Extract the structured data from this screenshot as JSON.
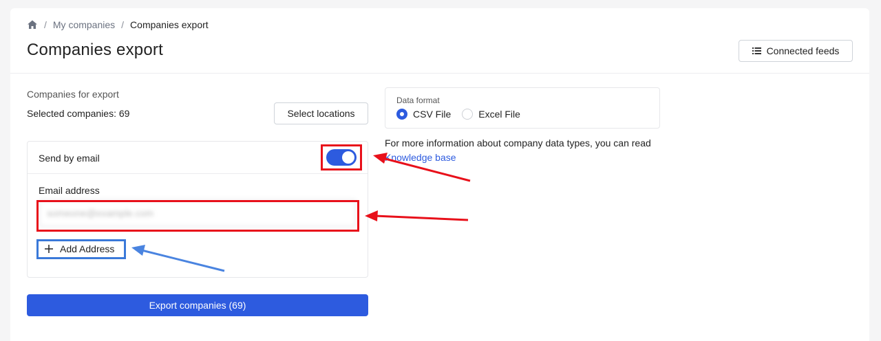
{
  "breadcrumb": {
    "home_icon": "home-icon",
    "separator": "/",
    "my_companies": "My companies",
    "current": "Companies export"
  },
  "header": {
    "title": "Companies export",
    "connected_feeds_label": "Connected feeds",
    "connected_feeds_icon": "list-icon"
  },
  "export": {
    "section_label": "Companies for export",
    "selected_text": "Selected companies: 69",
    "select_locations_label": "Select locations",
    "send_by_email_label": "Send by email",
    "send_by_email_enabled": true,
    "email_address_label": "Email address",
    "email_value": "someone@example.com",
    "add_address_label": "Add Address",
    "add_address_icon": "plus-icon",
    "export_button_label": "Export companies (69)"
  },
  "format": {
    "label": "Data format",
    "options": [
      {
        "label": "CSV File",
        "selected": true
      },
      {
        "label": "Excel File",
        "selected": false
      }
    ]
  },
  "info": {
    "text": "For more information about company data types, you can read",
    "link_label": "Knowledge base"
  },
  "colors": {
    "accent": "#2d5bdf",
    "highlight_red": "#e8101a",
    "highlight_blue": "#3a79d9"
  }
}
